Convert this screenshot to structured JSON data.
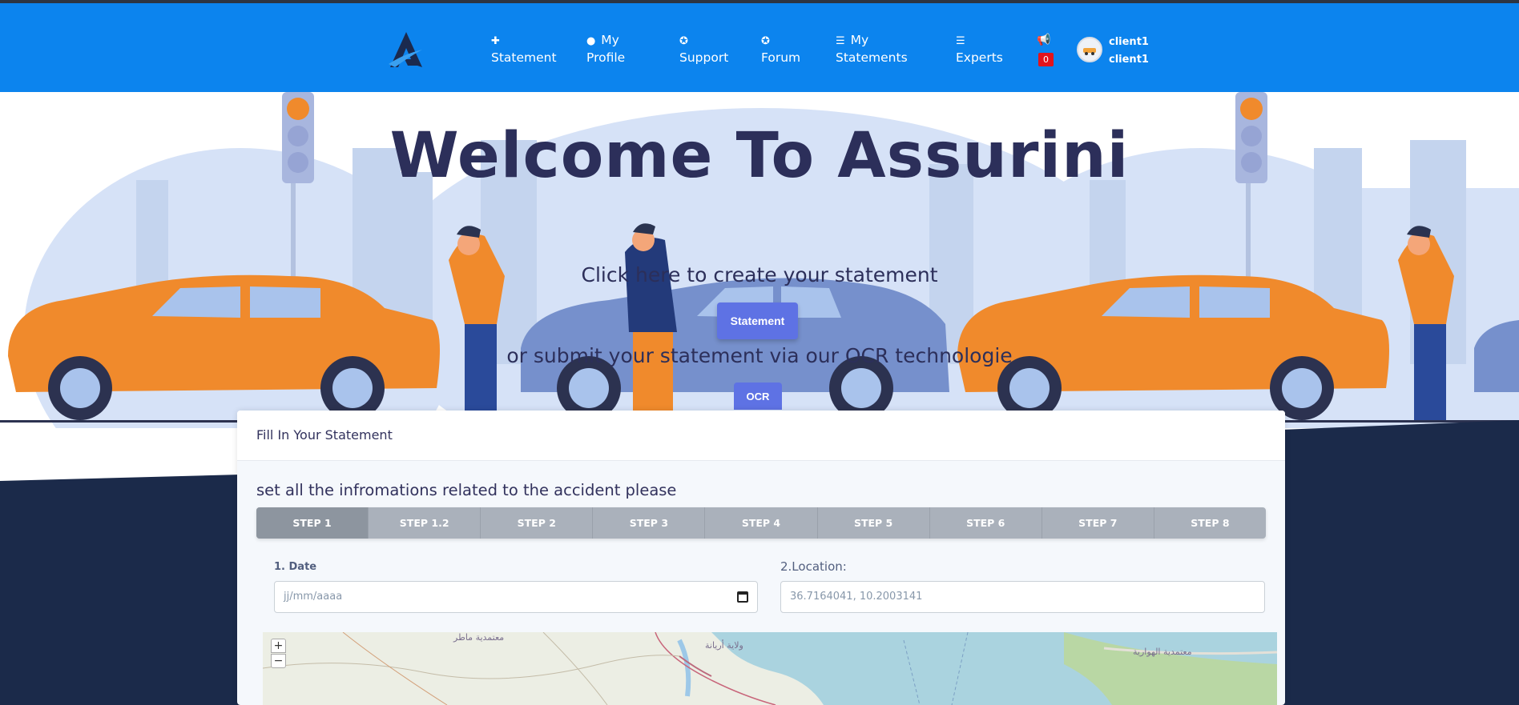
{
  "nav": {
    "items": [
      {
        "icon": "plus-icon",
        "label": "Statement"
      },
      {
        "icon": "user-circle-icon",
        "label": "My Profile"
      },
      {
        "icon": "lifebuoy-icon",
        "label": "Support"
      },
      {
        "icon": "lifebuoy-icon",
        "label": "Forum"
      },
      {
        "icon": "list-icon",
        "label": "My Statements"
      },
      {
        "icon": "list-icon",
        "label": "Experts"
      }
    ],
    "notifications_count": "0",
    "user_line1": "client1",
    "user_line2": "client1",
    "brand_color": "#0c84ee"
  },
  "hero": {
    "title": "Welcome To Assurini",
    "click_text": "Click here to create your statement",
    "statement_button": "Statement",
    "ocr_text": "or submit your statement via our OCR technologie",
    "ocr_button": "OCR"
  },
  "card": {
    "header": "Fill In Your Statement",
    "subtitle": "set all the infromations related to the accident please",
    "steps": [
      "STEP 1",
      "STEP 1.2",
      "STEP 2",
      "STEP 3",
      "STEP 4",
      "STEP 5",
      "STEP 6",
      "STEP 7",
      "STEP 8"
    ],
    "active_step": "STEP 1",
    "date_label": "1. Date",
    "date_placeholder": "jj/mm/aaaa",
    "location_label": "2.Location:",
    "location_value": "36.7164041, 10.2003141"
  },
  "map": {
    "zoom_in": "+",
    "zoom_out": "−",
    "labels": [
      "معتمدية ماطر",
      "ولاية أريانة",
      "معتمدية الهوارية"
    ]
  }
}
